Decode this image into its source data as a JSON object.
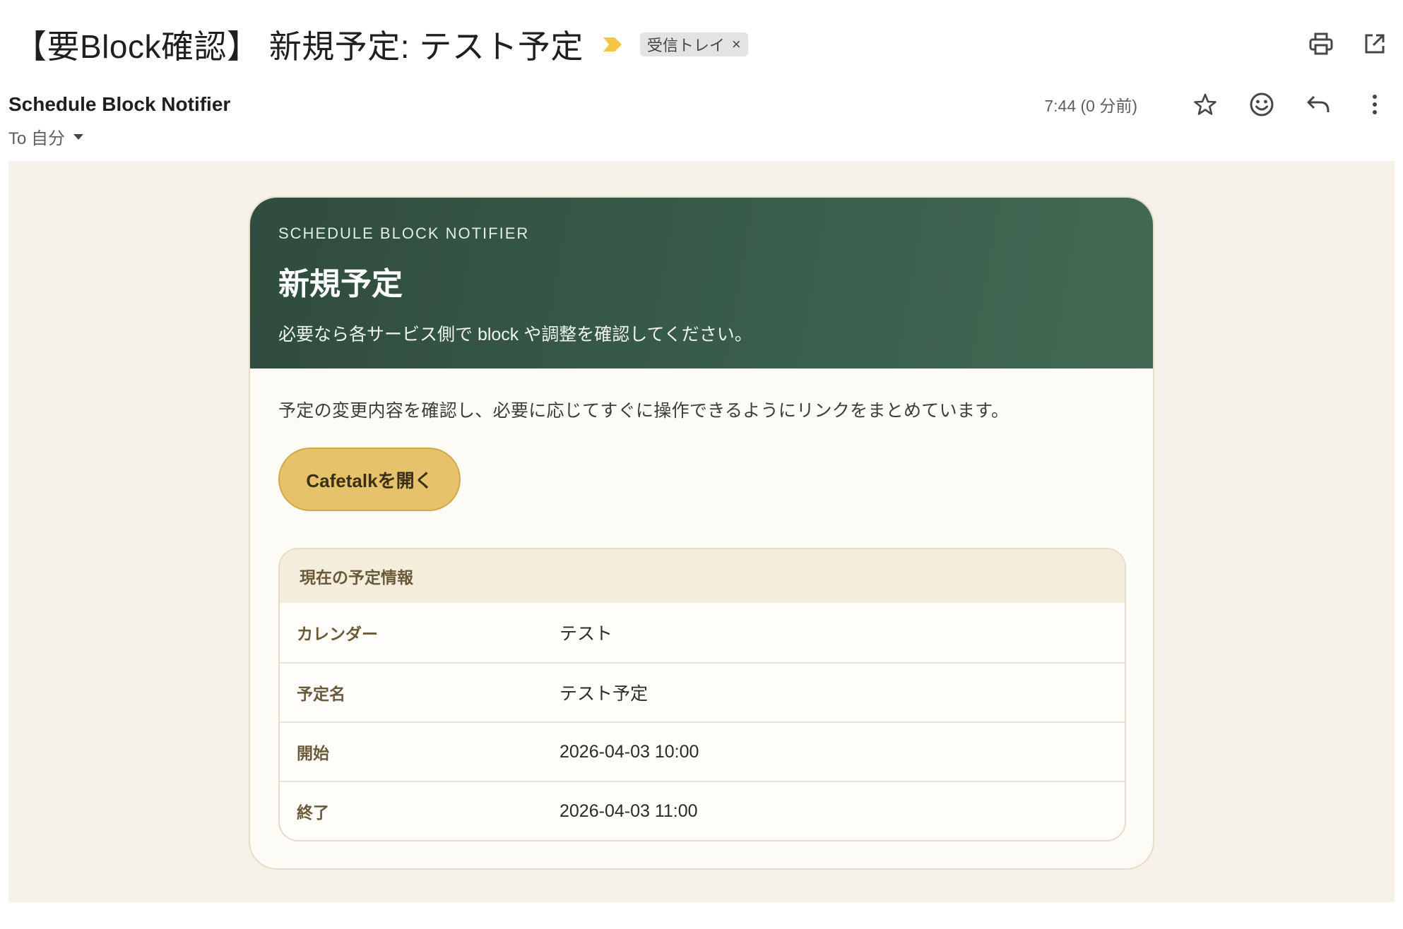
{
  "subject": {
    "title": "【要Block確認】 新規予定: テスト予定",
    "importance_icon": "importance-arrow-icon",
    "importance_color": "#f4c542",
    "label": "受信トレイ",
    "label_close": "×"
  },
  "header_actions": {
    "print_icon": "printer-icon",
    "open_new_window_icon": "open-in-new-icon"
  },
  "sender": {
    "name": "Schedule Block Notifier",
    "recipient": "To 自分"
  },
  "message_actions": {
    "timestamp": "7:44 (0 分前)",
    "icons": [
      "star-icon",
      "emoji-icon",
      "reply-icon",
      "more-vert-icon"
    ]
  },
  "card": {
    "eyebrow": "SCHEDULE BLOCK NOTIFIER",
    "title": "新規予定",
    "subtitle": "必要なら各サービス側で block や調整を確認してください。",
    "intro": "予定の変更内容を確認し、必要に応じてすぐに操作できるようにリンクをまとめています。",
    "cta_label": "Cafetalkを開く",
    "header_color": "#2f4c3e",
    "cta_color": "#e6c26a",
    "table": {
      "heading": "現在の予定情報",
      "rows": [
        {
          "key": "カレンダー",
          "value": "テスト"
        },
        {
          "key": "予定名",
          "value": "テスト予定"
        },
        {
          "key": "開始",
          "value": "2026-04-03 10:00"
        },
        {
          "key": "終了",
          "value": "2026-04-03 11:00"
        }
      ]
    }
  }
}
